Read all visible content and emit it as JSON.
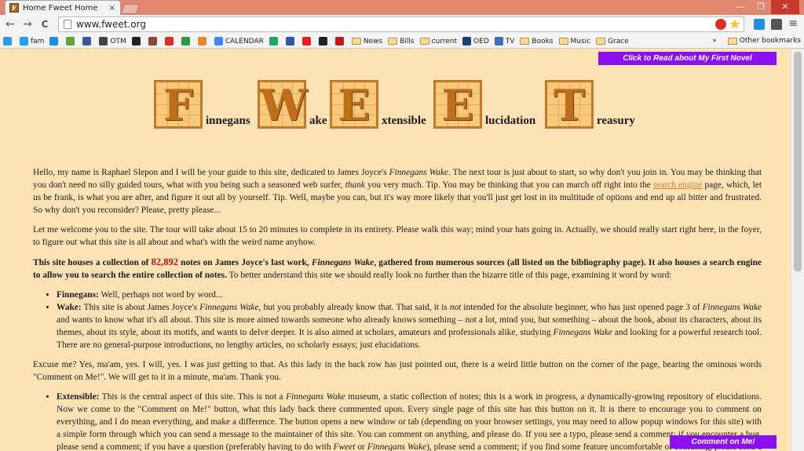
{
  "tab": {
    "title": "Home Fweet Home",
    "close": "×"
  },
  "window": {
    "minimize": "—",
    "restore": "❐",
    "close": "✕"
  },
  "nav": {
    "back": "←",
    "forward": "→",
    "reload": "C",
    "menu": "≡"
  },
  "omnibox": {
    "url": "www.fweet.org"
  },
  "bookmarks": [
    {
      "label": "",
      "icon": "pinterest-icon",
      "color": "#2e9be0"
    },
    {
      "label": "fam",
      "icon": "twitter-icon",
      "color": "#1da1f2"
    },
    {
      "label": "",
      "icon": "d-icon",
      "color": "#1f8fde"
    },
    {
      "label": "",
      "icon": "evernote-icon",
      "color": "#5fa62c"
    },
    {
      "label": "",
      "icon": "facebook-icon",
      "color": "#3b5998"
    },
    {
      "label": "OTM",
      "icon": "otm-icon",
      "color": "#444444"
    },
    {
      "label": "",
      "icon": "star-icon",
      "color": "#222222"
    },
    {
      "label": "",
      "icon": "book-icon",
      "color": "#8b4a2b"
    },
    {
      "label": "",
      "icon": "gmail-icon",
      "color": "#d93025"
    },
    {
      "label": "",
      "icon": "globe-icon",
      "color": "#2a9a3c"
    },
    {
      "label": "",
      "icon": "rss-icon",
      "color": "#e8882e"
    },
    {
      "label": "CALENDAR",
      "icon": "google-icon",
      "color": "#4285f4"
    },
    {
      "label": "",
      "icon": "drive-icon",
      "color": "#1fa463"
    },
    {
      "label": "",
      "icon": "flag-icon",
      "color": "#3355aa"
    },
    {
      "label": "",
      "icon": "youtube-icon",
      "color": "#e62117"
    },
    {
      "label": "",
      "icon": "amazon-icon",
      "color": "#222222"
    },
    {
      "label": "",
      "icon": "n-icon",
      "color": "#c11b17"
    },
    {
      "label": "News",
      "icon": "folder-icon",
      "color": "#f8de94"
    },
    {
      "label": "Bills",
      "icon": "folder-icon",
      "color": "#f8de94"
    },
    {
      "label": "current",
      "icon": "folder-icon",
      "color": "#f8de94"
    },
    {
      "label": "OED",
      "icon": "oed-icon",
      "color": "#1c3f7a"
    },
    {
      "label": "TV",
      "icon": "tv-icon",
      "color": "#3c6fbf"
    },
    {
      "label": "Books",
      "icon": "folder-icon",
      "color": "#f8de94"
    },
    {
      "label": "Music",
      "icon": "folder-icon",
      "color": "#f8de94"
    },
    {
      "label": "Grace",
      "icon": "folder-icon",
      "color": "#f8de94"
    }
  ],
  "bookmarks_overflow": "»",
  "other_bookmarks": "Other bookmarks",
  "novel_button": "Click to Read about My First Novel",
  "logo": {
    "letters": [
      "F",
      "W",
      "E",
      "E",
      "T"
    ],
    "words": [
      "innegans",
      "ake",
      "xtensible",
      "lucidation",
      "reasury"
    ]
  },
  "intro_1": "Hello, my name is Raphael Slepon and I will be your guide to this site, dedicated to James Joyce's ",
  "intro_1_book": "Finnegans Wake",
  "intro_2": ". The next tour is just about to start, so why don't you join in. You may be thinking that you don't need no silly guided tours, what with you being such a seasoned web surfer, ",
  "intro_2_em": "thank",
  "intro_3": " you very much. Tip. You may be thinking that you can march off right into the ",
  "search_link": "search engine",
  "intro_4": " page, which, let us be frank, is what you are after, and figure it out all by yourself. Tip. Well, maybe you can, but it's way more likely that you'll just get lost in its multitude of options and end up all bitter and frustrated. So why don't you reconsider? Please, pretty please...",
  "para_welcome": "Let me welcome you to the site. The tour will take about 15 to 20 minutes to complete in its entirety. Please walk this way; mind your hats going in. Actually, we should really start right here, in the foyer, to figure out what this site is all about and what's with the weird name anyhow.",
  "houses_1": "This site houses a collection of ",
  "note_count": "82,892",
  "houses_2": " notes on James Joyce's last work, ",
  "houses_book": "Finnegans Wake",
  "houses_3": ", gathered from numerous sources (all listed on the bibliography page). It also houses a search engine to allow you to search the entire collection of notes.",
  "houses_4": " To better understand this site we should really look no further than the bizarre title of this page, examining it word by word:",
  "bullet_finnegans_label": "Finnegans:",
  "bullet_finnegans_text": " Well, perhaps not word by word...",
  "bullet_wake_label": "Wake:",
  "bullet_wake_1": " This site is about James Joyce's ",
  "bullet_wake_book1": "Finnegans Wake",
  "bullet_wake_2": ", but you probably already know that. That said, it is ",
  "bullet_wake_not": "not",
  "bullet_wake_3": " intended for the absolute beginner, who has just opened page 3 of ",
  "bullet_wake_book2": "Finnegans Wake",
  "bullet_wake_4": " and wants to know what it's all about. This site is more aimed towards someone who already knows something – not a lot, mind you, but something – about the book, about its characters, about its themes, about its style, about its motifs, and wants to delve deeper. It is also aimed at scholars, amateurs and professionals alike, studying ",
  "bullet_wake_book3": "Finnegans Wake",
  "bullet_wake_5": " and looking for a powerful research tool. There are no general-purpose introductions, no lengthy articles, no scholarly essays; just elucidations.",
  "para_excuse": "Excuse me? Yes, ma'am, yes. I will, yes. I was just getting to that. As this lady in the back row has just pointed out, there is a weird little button on the corner of the page, bearing the ominous words \"Comment on Me!\". We will get to it in a minute, ma'am. Thank you.",
  "bullet_ext_label": "Extensible:",
  "bullet_ext_1": " This is the central aspect of this site. This is not a ",
  "bullet_ext_book": "Finnegans Wake",
  "bullet_ext_2": " museum, a static collection of notes; this is a work in progress, a dynamically-growing repository of elucidations. Now we come to the \"Comment on Me!\" button, what this lady back there commented upon. Every single page of this site has this button on it. It is there to encourage you to comment on everything, and I do mean everything, and make a difference. The button opens a new window or tab (depending on your browser settings, you may need to allow popup windows for this site) with a simple form through which you can send a message to the maintainer of this site. You can comment on anything, and please do. If you see a typo, please send a comment; if you encounter a bug, please send a comment; if you have a question (preferably having to do with ",
  "bullet_ext_fweet": "Fweet",
  "bullet_ext_or": " or ",
  "bullet_ext_book2": "Finnegans Wake",
  "bullet_ext_3": "), please send a comment; if you find some feature uncomfortable or confusing, please send a comment.",
  "comment_button": "Comment on Me!"
}
